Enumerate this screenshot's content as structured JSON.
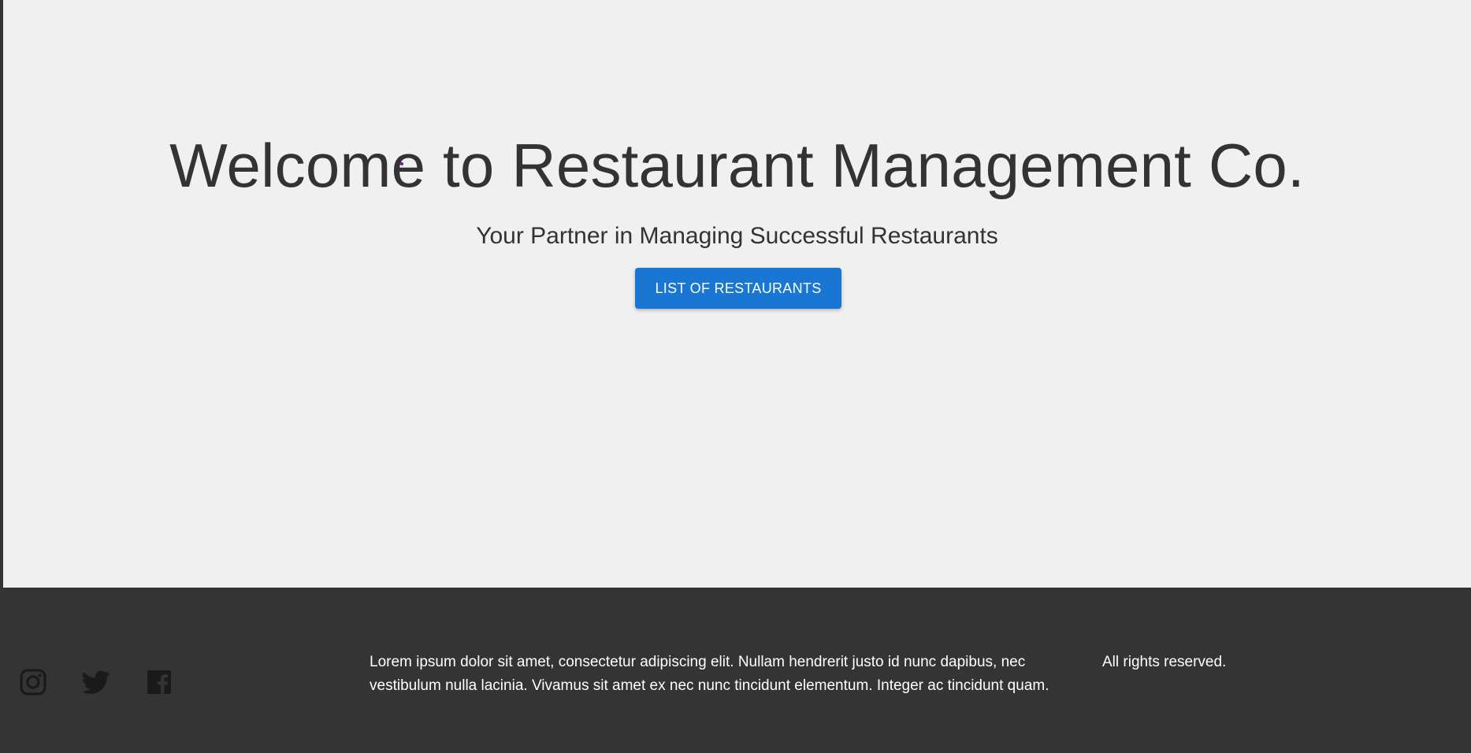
{
  "hero": {
    "title": "Welcome to Restaurant Management Co.",
    "subtitle": "Your Partner in Managing Successful Restaurants",
    "cta_label": "LIST OF RESTAURANTS"
  },
  "footer": {
    "social": [
      {
        "name": "instagram",
        "icon": "instagram-icon"
      },
      {
        "name": "twitter",
        "icon": "twitter-icon"
      },
      {
        "name": "facebook",
        "icon": "facebook-icon"
      }
    ],
    "description": "Lorem ipsum dolor sit amet, consectetur adipiscing elit. Nullam hendrerit justo id nunc dapibus, nec vestibulum nulla lacinia. Vivamus sit amet ex nec nunc tincidunt elementum. Integer ac tincidunt quam.",
    "rights": "All rights reserved."
  },
  "colors": {
    "hero_background": "#f0f0f0",
    "footer_background": "#343434",
    "accent": "#1976d2",
    "text_dark": "#333333",
    "text_light": "#ffffff",
    "icon_color": "#1a1a1a"
  }
}
